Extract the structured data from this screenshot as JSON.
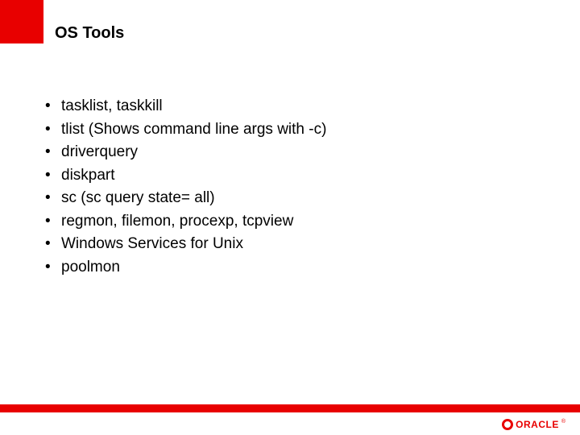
{
  "title": "OS Tools",
  "bullets": [
    "tasklist, taskkill",
    "tlist (Shows command line args with -c)",
    "driverquery",
    "diskpart",
    "sc (sc query state= all)",
    "regmon, filemon, procexp, tcpview",
    "Windows Services for Unix",
    "poolmon"
  ],
  "logo_text": "ORACLE",
  "logo_reg": "®"
}
